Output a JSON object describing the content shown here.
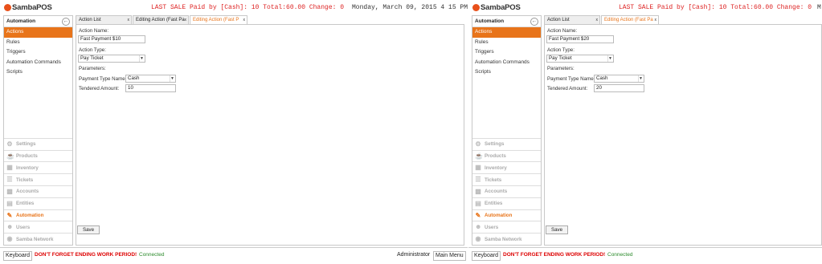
{
  "app": {
    "logo": "SambaPOS",
    "brand_color": "#e8501a",
    "accent_color": "#e8741a"
  },
  "panel1": {
    "last_sale": "LAST SALE Paid by [Cash]: 10 Total:60.00 Change: 0",
    "datetime": "Monday, March 09, 2015 4 15 PM",
    "sidebar": {
      "title": "Automation",
      "items": [
        "Actions",
        "Rules",
        "Triggers",
        "Automation Commands",
        "Scripts"
      ],
      "nav": [
        "Settings",
        "Products",
        "Inventory",
        "Tickets",
        "Accounts",
        "Entities",
        "Automation",
        "Users",
        "Samba Network"
      ]
    },
    "tabs": [
      "Action List",
      "Editing Action (Fast Pa",
      "Editing Action (Fast P"
    ],
    "form": {
      "action_name_label": "Action Name:",
      "action_name_value": "Fast Payment $10",
      "action_type_label": "Action Type:",
      "action_type_value": "Pay Ticket",
      "parameters_label": "Parameters:",
      "payment_type_label": "Payment Type Name:",
      "payment_type_value": "Cash",
      "tendered_label": "Tendered Amount:",
      "tendered_value": "10",
      "save_label": "Save"
    },
    "bottom": {
      "keyboard": "Keyboard",
      "warning": "DON'T FORGET ENDING WORK PERIOD!",
      "connected": "Connected",
      "admin": "Administrator",
      "main_menu": "Main Menu"
    }
  },
  "panel2": {
    "last_sale": "LAST SALE Paid by [Cash]: 10 Total:60.00 Change: 0",
    "datetime": "M",
    "sidebar": {
      "title": "Automation",
      "items": [
        "Actions",
        "Rules",
        "Triggers",
        "Automation Commands",
        "Scripts"
      ],
      "nav": [
        "Settings",
        "Products",
        "Inventory",
        "Tickets",
        "Accounts",
        "Entities",
        "Automation",
        "Users",
        "Samba Network"
      ]
    },
    "tabs": [
      "Action List",
      "Editing Action (Fast Pa"
    ],
    "form": {
      "action_name_label": "Action Name:",
      "action_name_value": "Fast Payment $20",
      "action_type_label": "Action Type:",
      "action_type_value": "Pay Ticket",
      "parameters_label": "Parameters:",
      "payment_type_label": "Payment Type Name:",
      "payment_type_value": "Cash",
      "tendered_label": "Tendered Amount:",
      "tendered_value": "20",
      "save_label": "Save"
    },
    "bottom": {
      "keyboard": "Keyboard",
      "warning": "DON'T FORGET ENDING WORK PERIOD!",
      "connected": "Connected"
    }
  }
}
